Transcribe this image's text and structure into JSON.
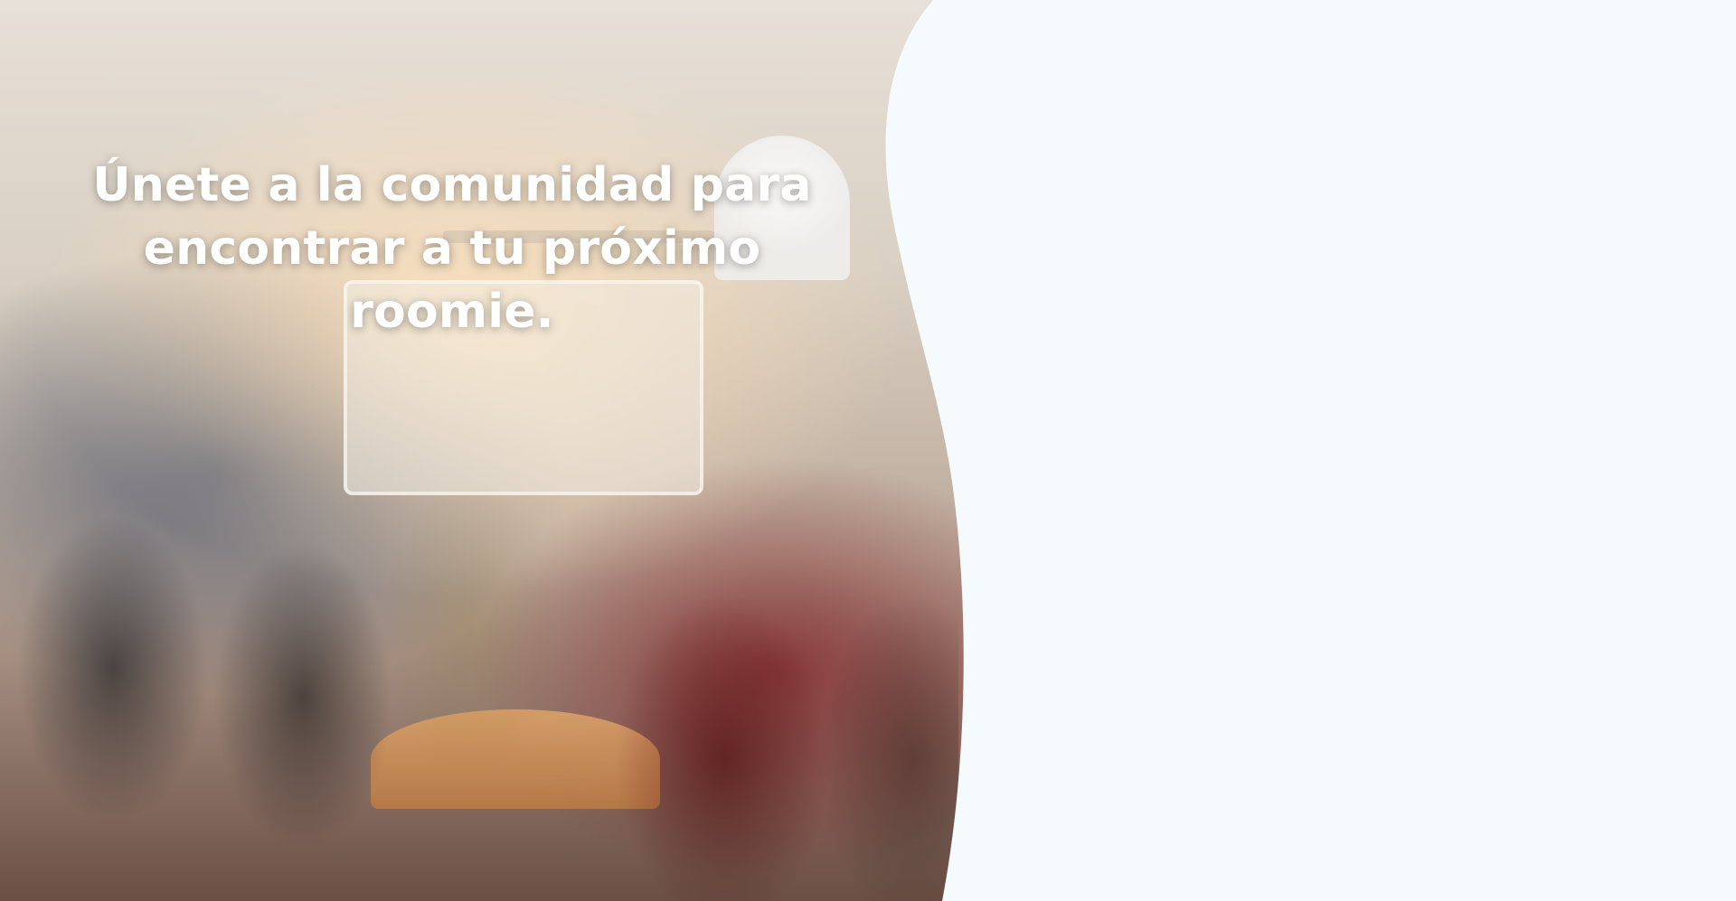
{
  "hero": {
    "headline": "Únete a la comunidad para encontrar a tu próximo roomie."
  },
  "colors": {
    "right_panel_bg": "#F5FAFD",
    "headline_text": "#FFFFFF"
  }
}
